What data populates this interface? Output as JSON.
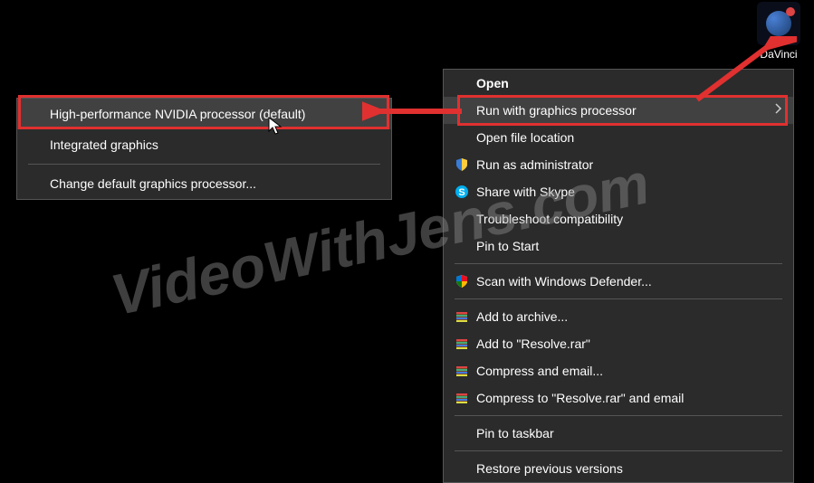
{
  "desktop": {
    "app_label": "DaVinci"
  },
  "main_menu": {
    "open": "Open",
    "run_gpu": "Run with graphics processor",
    "open_location": "Open file location",
    "run_admin": "Run as administrator",
    "share_skype": "Share with Skype",
    "troubleshoot": "Troubleshoot compatibility",
    "pin_start": "Pin to Start",
    "scan_defender": "Scan with Windows Defender...",
    "add_archive": "Add to archive...",
    "add_resolve": "Add to \"Resolve.rar\"",
    "compress_email": "Compress and email...",
    "compress_resolve_email": "Compress to \"Resolve.rar\" and email",
    "pin_taskbar": "Pin to taskbar",
    "restore": "Restore previous versions"
  },
  "sub_menu": {
    "nvidia": "High-performance NVIDIA processor (default)",
    "integrated": "Integrated graphics",
    "change_default": "Change default graphics processor..."
  },
  "watermark": "VideoWithJens.com",
  "colors": {
    "highlight": "#e03030",
    "menu_bg": "#2b2b2b",
    "menu_hover": "#414141"
  }
}
